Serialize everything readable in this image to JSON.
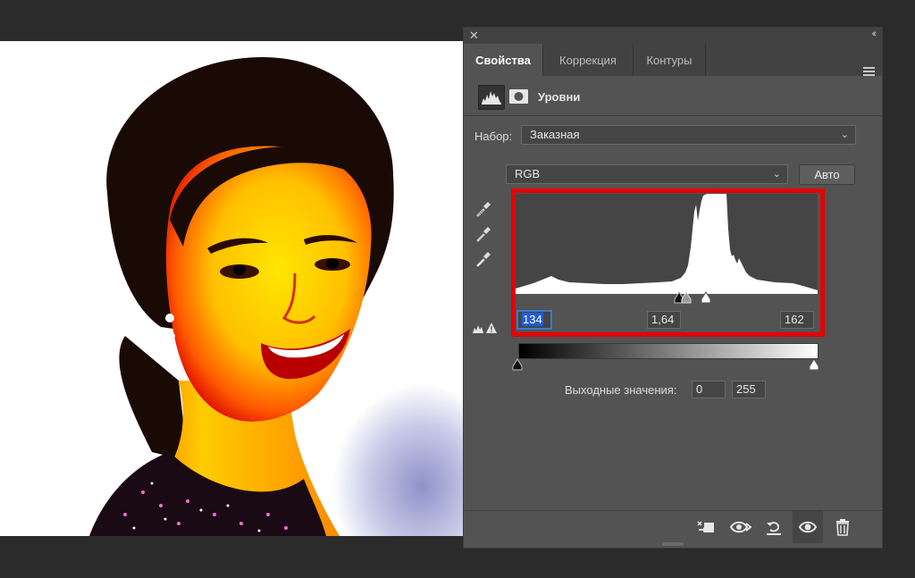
{
  "panel": {
    "close_glyph": "✕",
    "collapse_glyph": "‹‹",
    "tabs": [
      {
        "label": "Свойства",
        "active": true
      },
      {
        "label": "Коррекция",
        "active": false
      },
      {
        "label": "Контуры",
        "active": false
      }
    ],
    "menu_icon": "hamburger-menu-icon",
    "adjustment_title": "Уровни",
    "preset_label": "Набор:",
    "preset_value": "Заказная",
    "channel_value": "RGB",
    "auto_label": "Авто",
    "input_black": "134",
    "input_gamma": "1,64",
    "input_white": "162",
    "output_label": "Выходные значения:",
    "output_black": "0",
    "output_white": "255"
  },
  "colors": {
    "panel_bg": "#535353",
    "highlight": "#e60000",
    "focus": "#3d7bd1"
  },
  "chev": "⌄"
}
